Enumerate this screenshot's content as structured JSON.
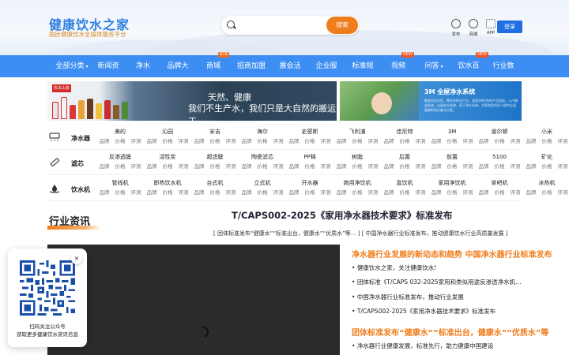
{
  "header": {
    "logo_main": "健康饮水之家",
    "logo_sub": "国民健康饮水全媒体服务平台",
    "search_placeholder": "",
    "search_button": "搜索",
    "icons": [
      {
        "label": "发布",
        "icon": "publish-icon"
      },
      {
        "label": "商城",
        "icon": "shop-icon"
      },
      {
        "label": "APP",
        "icon": "app-grid-icon"
      }
    ],
    "login_label": "登录"
  },
  "nav": {
    "items": [
      {
        "label": "全部分类",
        "caret": true
      },
      {
        "label": "新闻资讯"
      },
      {
        "label": "净水器"
      },
      {
        "label": "品牌大全"
      },
      {
        "label": "商城",
        "badge": "B2B"
      },
      {
        "label": "招商加盟",
        "caret": true
      },
      {
        "label": "展会活动"
      },
      {
        "label": "企业服务"
      },
      {
        "label": "标准规范"
      },
      {
        "label": "视频",
        "badge": "NEW"
      },
      {
        "label": "问答",
        "caret": true
      },
      {
        "label": "饮水百科",
        "badge": "NEW"
      },
      {
        "label": "行业数据"
      }
    ]
  },
  "banners": {
    "left_brand": "农夫山泉",
    "left_line1": "天然、健康",
    "left_line2": "我们不生产水，我们只是大自然的搬运工",
    "right_title": "3M 全屋净水系统",
    "right_body": "聚焦饮用水质，整合多种水产品，成就3M优秀的产品组成，入户精滤系统，全屋软水系统，厨下净水系统，为您和您的家人提供全面健康的用水解决方案。"
  },
  "categories": [
    {
      "name": "净水器",
      "icon": "water-purifier-icon",
      "cells": [
        {
          "head": "美的",
          "subs": [
            "品牌",
            "价格",
            "评测"
          ]
        },
        {
          "head": "沁园",
          "subs": [
            "品牌",
            "价格",
            "评测"
          ]
        },
        {
          "head": "安吉",
          "subs": [
            "品牌",
            "价格",
            "评测"
          ]
        },
        {
          "head": "海尔",
          "subs": [
            "品牌",
            "价格",
            "评测"
          ]
        },
        {
          "head": "史密斯",
          "subs": [
            "品牌",
            "价格",
            "评测"
          ]
        },
        {
          "head": "飞利浦",
          "subs": [
            "品牌",
            "价格",
            "评测"
          ]
        },
        {
          "head": "佳尼特",
          "subs": [
            "品牌",
            "价格",
            "评测"
          ]
        },
        {
          "head": "3M",
          "subs": [
            "品牌",
            "价格",
            "评测"
          ]
        },
        {
          "head": "道尔顿",
          "subs": [
            "品牌",
            "价格",
            "评测"
          ]
        },
        {
          "head": "小米",
          "subs": [
            "品牌",
            "价格",
            "评测"
          ]
        }
      ]
    },
    {
      "name": "滤芯",
      "icon": "filter-cartridge-icon",
      "cells": [
        {
          "head": "反渗透膜",
          "subs": [
            "品牌",
            "价格",
            "评测"
          ]
        },
        {
          "head": "活性炭",
          "subs": [
            "品牌",
            "价格",
            "评测"
          ]
        },
        {
          "head": "超滤膜",
          "subs": [
            "品牌",
            "价格",
            "评测"
          ]
        },
        {
          "head": "陶瓷滤芯",
          "subs": [
            "品牌",
            "价格",
            "评测"
          ]
        },
        {
          "head": "PP棉",
          "subs": [
            "品牌",
            "价格",
            "评测"
          ]
        },
        {
          "head": "树脂",
          "subs": [
            "品牌",
            "价格",
            "评测"
          ]
        },
        {
          "head": "后置",
          "subs": [
            "品牌",
            "价格",
            "评测"
          ]
        },
        {
          "head": "前置",
          "subs": [
            "品牌",
            "价格",
            "评测"
          ]
        },
        {
          "head": "5100",
          "subs": [
            "品牌",
            "价格",
            "评测"
          ]
        },
        {
          "head": "矿化",
          "subs": [
            "品牌",
            "价格",
            "评测"
          ]
        }
      ]
    },
    {
      "name": "饮水机",
      "icon": "water-drop-hand-icon",
      "cells": [
        {
          "head": "管线机",
          "subs": [
            "品牌",
            "价格",
            "评测"
          ]
        },
        {
          "head": "即热饮水机",
          "subs": [
            "品牌",
            "价格",
            "评测"
          ]
        },
        {
          "head": "台式机",
          "subs": [
            "品牌",
            "价格",
            "评测"
          ]
        },
        {
          "head": "立式机",
          "subs": [
            "品牌",
            "价格",
            "评测"
          ]
        },
        {
          "head": "开水器",
          "subs": [
            "品牌",
            "价格",
            "评测"
          ]
        },
        {
          "head": "商用净饮机",
          "subs": [
            "品牌",
            "价格",
            "评测"
          ]
        },
        {
          "head": "直饮机",
          "subs": [
            "品牌",
            "价格",
            "评测"
          ]
        },
        {
          "head": "家用净饮机",
          "subs": [
            "品牌",
            "价格",
            "评测"
          ]
        },
        {
          "head": "茶吧机",
          "subs": [
            "品牌",
            "价格",
            "评测"
          ]
        },
        {
          "head": "冰热机",
          "subs": [
            "品牌",
            "价格",
            "评测"
          ]
        }
      ]
    }
  ],
  "news": {
    "section_title": "行业资讯",
    "article_title": "T/CAPS002-2025《家用净水器技术要求》标准发布",
    "article_sub": "[ 团体标准发布“健康水”“标准出台，健康水”“优质水”等... ] [ 中国净水器行业标准发布，推动健康饮水行业高质量发展 ]",
    "list1_head": "净水器行业发展的新动态和趋势 中国净水器行业标准发布",
    "list1": [
      "健康饮水之家，关注健康饮水!",
      "团体标准《T/CAPS 032-2025家用和类似用途反渗透净水机》正式发布并实施",
      "中国净水器行业标准发布，推动行业发展",
      "T/CAPS002-2025《家用净水器技术要求》标准发布"
    ],
    "list2_head": "团体标准发布“健康水”“标准出台，健康水”“优质水”等",
    "list2": [
      "净水器行业健康发展，标准先行，助力健康中国建设"
    ]
  },
  "qr": {
    "close": "×",
    "line1": "扫码关注公众号",
    "line2": "获取更多健康饮水资讯信息"
  }
}
